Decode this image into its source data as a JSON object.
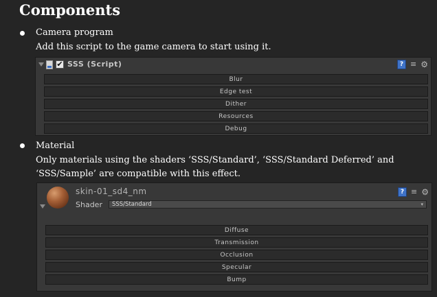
{
  "heading": "Components",
  "items": [
    {
      "title": "Camera program",
      "description": "Add this script to the game camera to start using it."
    },
    {
      "title": "Material",
      "description": "Only materials using the shaders ‘SSS/Standard’, ‘SSS/Standard Deferred’ and ‘SSS/Sample’ are compatible with this effect."
    }
  ],
  "script_panel": {
    "title": "SSS (Script)",
    "enabled_mark": "✔",
    "icons": [
      "script-icon",
      "help-icon",
      "preset-icon",
      "gear-icon"
    ],
    "help_glyph": "?",
    "preset_glyph": "≡",
    "gear_glyph": "⚙",
    "tabs": [
      "Blur",
      "Edge test",
      "Dither",
      "Resources",
      "Debug"
    ]
  },
  "material_panel": {
    "name": "skin-01_sd4_nm",
    "shader_label": "Shader",
    "shader_value": "SSS/Standard",
    "dropdown_glyph": "▾",
    "help_glyph": "?",
    "preset_glyph": "≡",
    "gear_glyph": "⚙",
    "tabs": [
      "Diffuse",
      "Transmission",
      "Occlusion",
      "Specular",
      "Bump"
    ]
  },
  "colors": {
    "background": "#252525",
    "panel": "#383838",
    "tab": "#2b2b2b",
    "help_icon": "#3f73c8"
  }
}
